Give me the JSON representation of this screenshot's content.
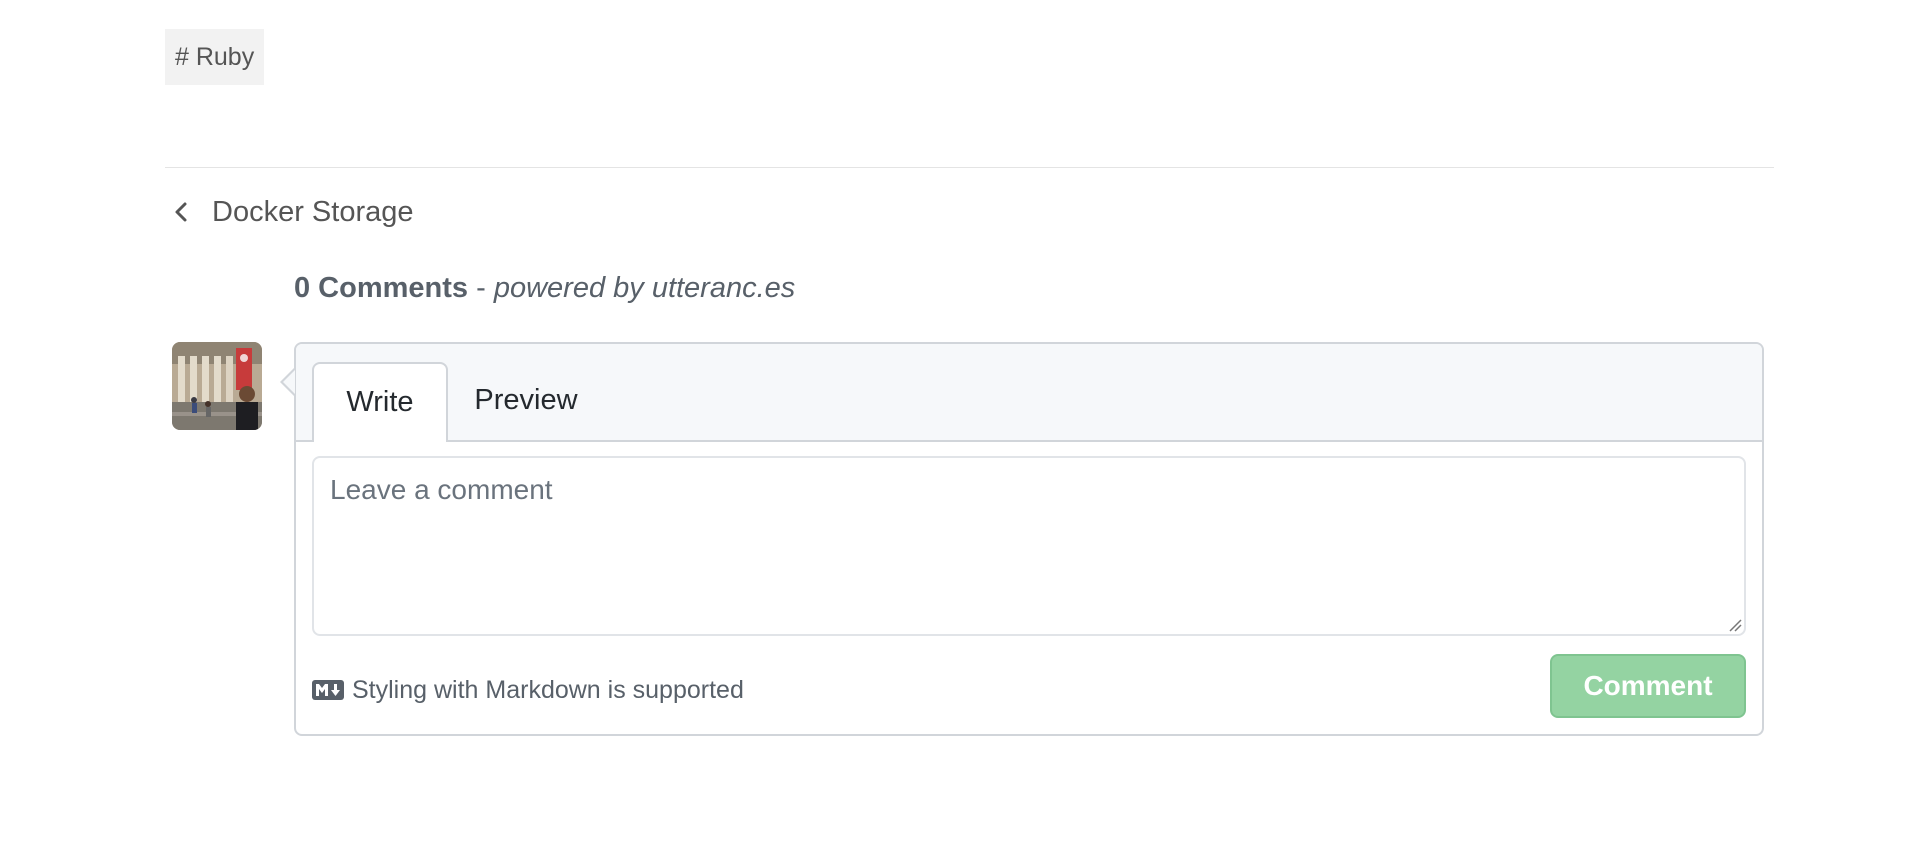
{
  "tag": {
    "label": "# Ruby"
  },
  "navigation": {
    "previous_post": "Docker Storage",
    "previous_icon": "chevron-left-icon"
  },
  "comments": {
    "count_label": "0 Comments",
    "separator": " - ",
    "powered_by": "powered by utteranc.es"
  },
  "editor": {
    "tabs": [
      {
        "label": "Write",
        "selected": true
      },
      {
        "label": "Preview",
        "selected": false
      }
    ],
    "placeholder": "Leave a comment",
    "value": "",
    "markdown_note": "Styling with Markdown is supported",
    "markdown_icon": "markdown-icon",
    "submit_label": "Comment",
    "submit_enabled": false
  },
  "colors": {
    "submit_bg": "#94d3a2",
    "header_bg": "#f6f8fa",
    "border": "#d1d5da",
    "muted_text": "#586069",
    "tag_bg": "#f2f2f2"
  }
}
